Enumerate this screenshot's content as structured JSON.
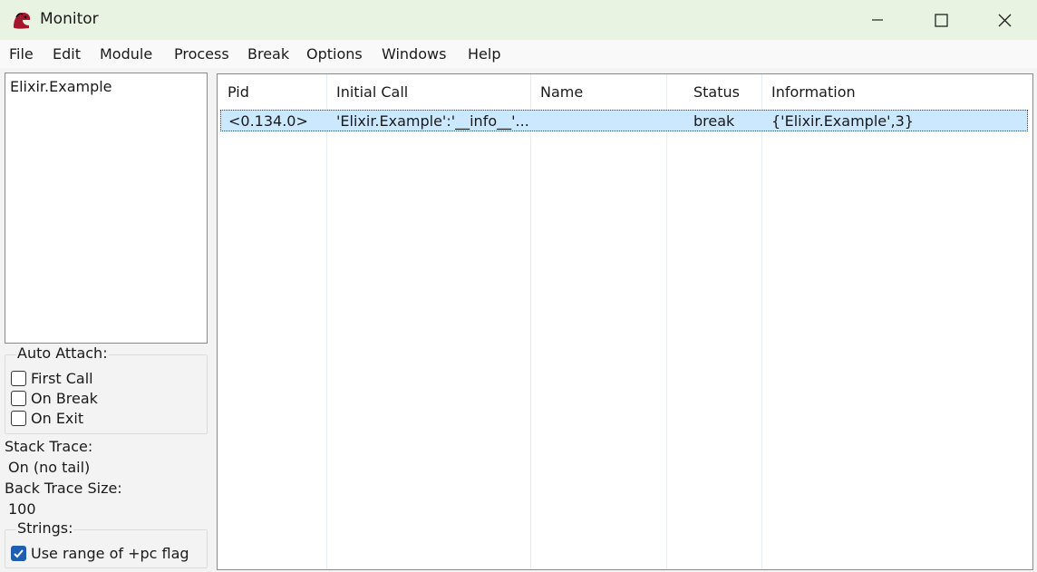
{
  "window": {
    "title": "Monitor"
  },
  "menu": [
    "File",
    "Edit",
    "Module",
    "Process",
    "Break",
    "Options",
    "Windows",
    "Help"
  ],
  "modules": [
    "Elixir.Example"
  ],
  "auto_attach": {
    "legend": "Auto Attach:",
    "options": [
      {
        "label": "First Call",
        "checked": false
      },
      {
        "label": "On Break",
        "checked": false
      },
      {
        "label": "On Exit",
        "checked": false
      }
    ]
  },
  "stack_trace": {
    "label": "Stack Trace:",
    "value": "On (no tail)"
  },
  "back_trace": {
    "label": "Back Trace Size:",
    "value": "100"
  },
  "strings": {
    "legend": "Strings:",
    "option": {
      "label": "Use range of +pc flag",
      "checked": true
    }
  },
  "table": {
    "columns": [
      "Pid",
      "Initial Call",
      "Name",
      "Status",
      "Information"
    ],
    "rows": [
      [
        "<0.134.0>",
        "'Elixir.Example':'__info__'...",
        "",
        "break",
        "{'Elixir.Example',3}"
      ]
    ]
  }
}
